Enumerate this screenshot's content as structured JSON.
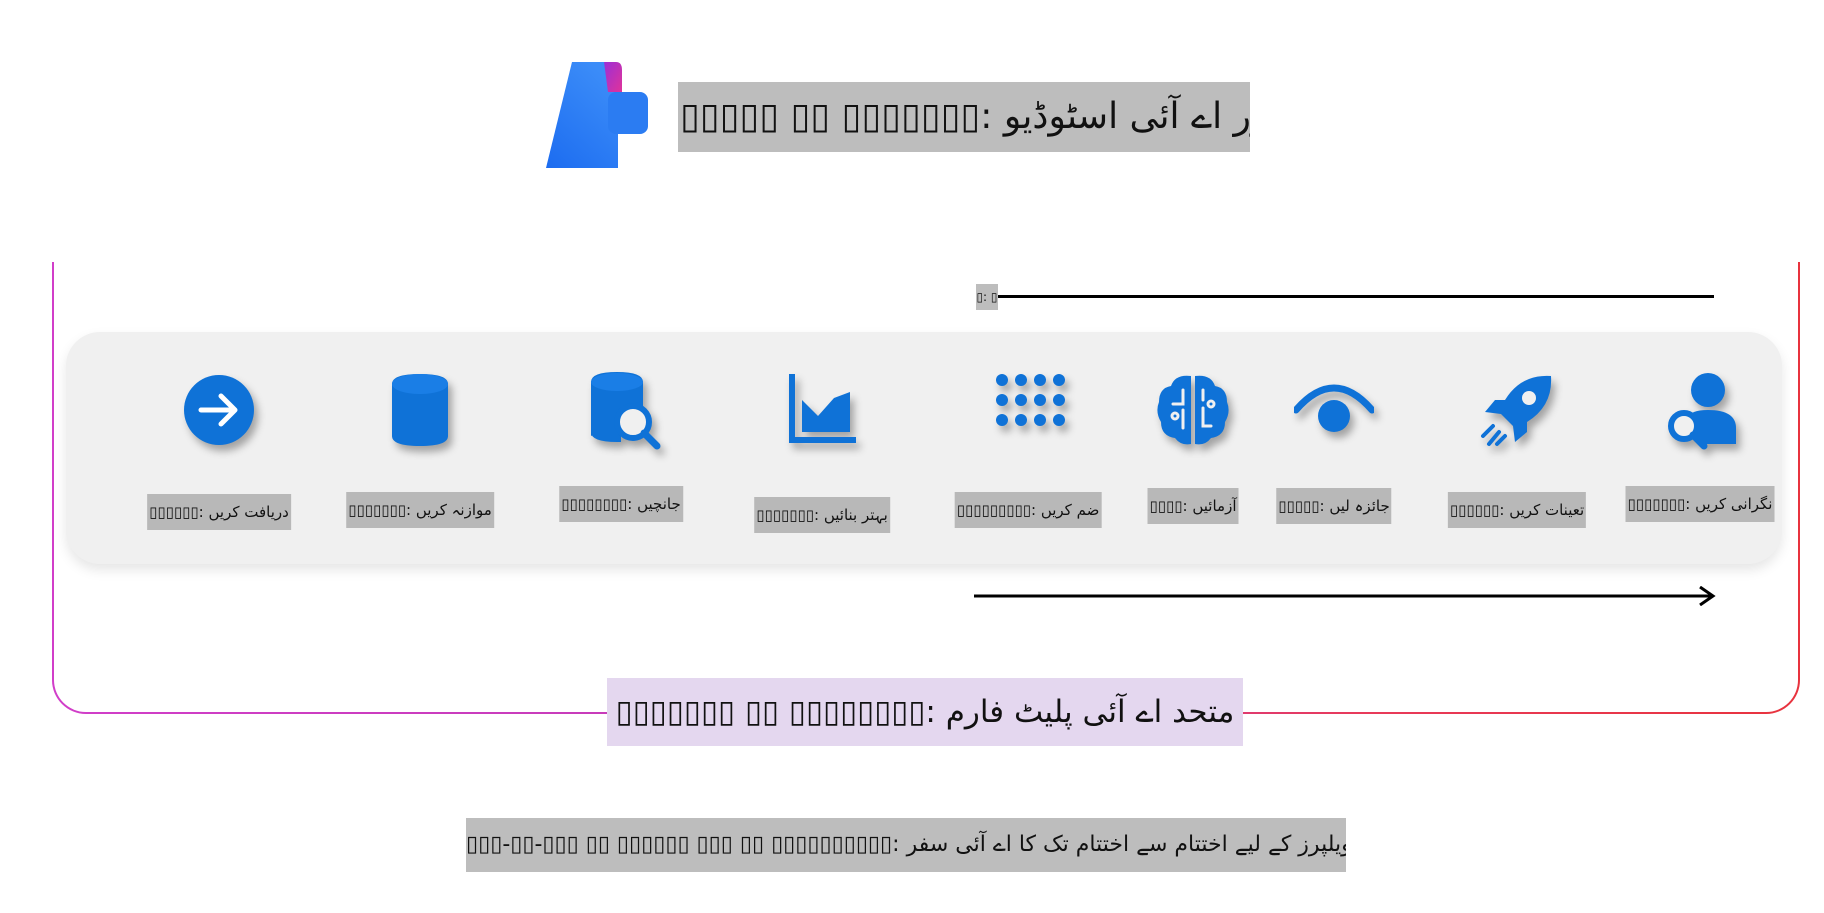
{
  "header": {
    "logo_icon": "azure-ai-studio-logo",
    "title": "▯▯▯▯▯ ▯▯ ▯▯▯▯▯▯▯: ایزور اے آئی اسٹوڈیو"
  },
  "timeline_label": "▯: ▯",
  "steps": [
    {
      "icon": "arrow-right-circle-icon",
      "label": "▯▯▯▯▯▯: دریافت کریں"
    },
    {
      "icon": "database-icon",
      "label": "▯▯▯▯▯▯▯: موازنہ کریں"
    },
    {
      "icon": "database-search-icon",
      "label": "▯▯▯▯▯▯▯▯: جانچیں"
    },
    {
      "icon": "area-chart-icon",
      "label": "▯▯▯▯▯▯▯: بہتر بنائیں"
    },
    {
      "icon": "dot-grid-icon",
      "label": "▯▯▯▯▯▯▯▯▯: ضم کریں"
    },
    {
      "icon": "brain-icon",
      "label": "▯▯▯▯: آزمائیں"
    },
    {
      "icon": "eye-icon",
      "label": "▯▯▯▯▯: جائزہ لیں"
    },
    {
      "icon": "rocket-icon",
      "label": "▯▯▯▯▯▯: تعینات کریں"
    },
    {
      "icon": "person-search-icon",
      "label": "▯▯▯▯▯▯▯: نگرانی کریں"
    }
  ],
  "platform_title": "▯▯▯▯▯▯▯ ▯▯ ▯▯▯▯▯▯▯▯: متحد اے آئی پلیٹ فارم",
  "footer_text": "▯▯▯-▯▯-▯▯▯ ▯▯ ▯▯▯▯▯▯ ▯▯▯ ▯▯ ▯▯▯▯▯▯▯▯▯▯: اے آئی ڈویلپرز کے لیے اختتام سے اختتام تک کا اے آئی سفر",
  "colors": {
    "icon_blue": "#0f72d7",
    "panel_bg": "#f0f0f0",
    "frame_gradient_start": "#d13ec9",
    "frame_gradient_end": "#e8333e",
    "platform_highlight": "#e4d7ef",
    "label_highlight": "#b8b8b8"
  }
}
